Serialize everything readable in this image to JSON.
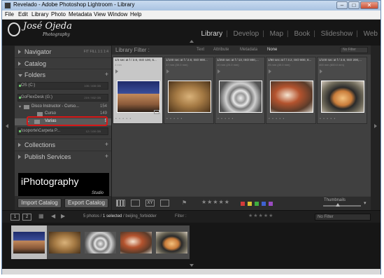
{
  "window": {
    "title": "Revelado - Adobe Photoshop Lightroom - Library",
    "controls": [
      "–",
      "□",
      "✕"
    ]
  },
  "menu": [
    "File",
    "Edit",
    "Library",
    "Photo",
    "Metadata",
    "View",
    "Window",
    "Help"
  ],
  "identity_plate": {
    "name": "José Ojeda",
    "sub": "Photography"
  },
  "modules": [
    "Library",
    "Develop",
    "Map",
    "Book",
    "Slideshow",
    "Web"
  ],
  "navigator": {
    "label": "Navigator",
    "zoom": [
      "FIT",
      "FILL",
      "1:1",
      "1:4"
    ]
  },
  "catalog": {
    "label": "Catalog"
  },
  "folders": {
    "label": "Folders",
    "volumes": [
      {
        "name": "OS (C:)",
        "size": "106 / 408 GB"
      },
      {
        "name": "GoFlexDesk (G:)",
        "size": "219 / 932 GB"
      },
      {
        "name": "\\\\soporte\\Carpeta P...",
        "size": "12 / 100 GB"
      }
    ],
    "items": [
      {
        "name": "Disco Instructor - Curso...",
        "count": "154"
      },
      {
        "name": "Curso",
        "count": "149"
      },
      {
        "name": "Varias",
        "count": "5"
      }
    ]
  },
  "collections": {
    "label": "Collections"
  },
  "publish": {
    "label": "Publish Services"
  },
  "promo": {
    "text": "iPhotography",
    "sub": "Studio"
  },
  "import_label": "Import Catalog",
  "export_label": "Export Catalog",
  "filter": {
    "title": "Library Filter :",
    "tabs": [
      "Text",
      "Attribute",
      "Metadata",
      "None"
    ],
    "no_filter": "No Filter"
  },
  "photos": [
    {
      "meta": "1/4 sec at f / 2.8, ISO 100, 6...",
      "sub": "4 mm"
    },
    {
      "meta": "1/100 sec at f / 2.8, ISO 800...",
      "sub": "17 mm (30.0 mm)"
    },
    {
      "meta": "1/250 sec at f / 13, ISO 800,...",
      "sub": "10 mm (20.0 mm)"
    },
    {
      "meta": "1/80 sec at f / 3.2, ISO 800, 8...",
      "sub": "25 mm (40.0 mm)"
    },
    {
      "meta": "1/100 sec at f / 2.8, ISO 200,...",
      "sub": "400 mm (600.0 mm)"
    }
  ],
  "toolbar": {
    "views": [
      "grid",
      "loupe",
      "XY",
      "survey"
    ],
    "thumbnails_label": "Thumbnails"
  },
  "color_labels": [
    "#d23a3a",
    "#d8c232",
    "#3fae3f",
    "#3f62d0",
    "#9a4bc0"
  ],
  "filmstrip_bar": {
    "pages": [
      "1",
      "2"
    ],
    "text_pre": "5 photos / ",
    "text_sel": "1 selected",
    "text_post": " / beijing_forbidder",
    "filter_label": "Filter :",
    "no_filter": "No Filter"
  }
}
